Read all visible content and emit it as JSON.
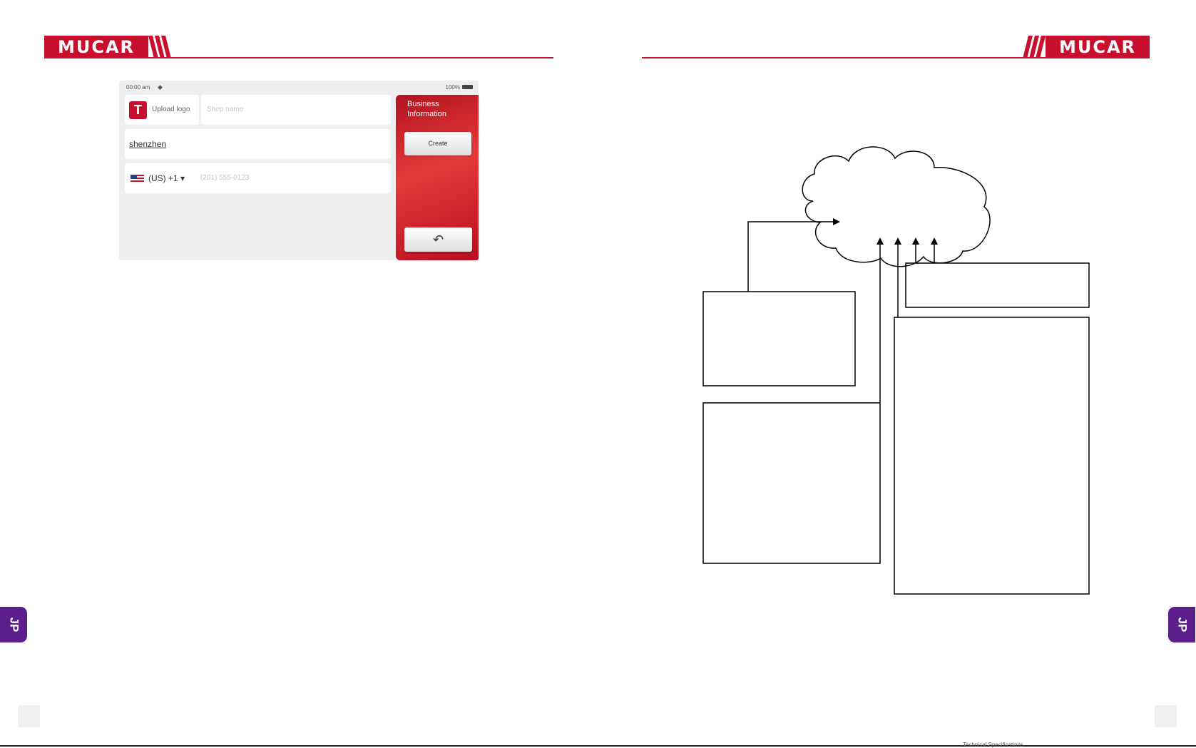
{
  "brand": {
    "name": "MUCAR",
    "color": "#c8102e"
  },
  "screen": {
    "status": {
      "time": "00:00 am",
      "wifi_icon": "wifi-icon",
      "battery": "100%"
    },
    "upload_logo_label": "Upload logo",
    "shop_name_placeholder": "Shop name",
    "city_value": "shenzhen",
    "country_code": "(US) +1 ▾",
    "phone_placeholder": "(201) 555-0123",
    "panel_title": "Business Information",
    "create_label": "Create",
    "back_icon": "↶"
  },
  "side_tab": {
    "label": "JP",
    "color": "#5b1f8c"
  },
  "footer": {
    "text": "Technical Specifications"
  }
}
